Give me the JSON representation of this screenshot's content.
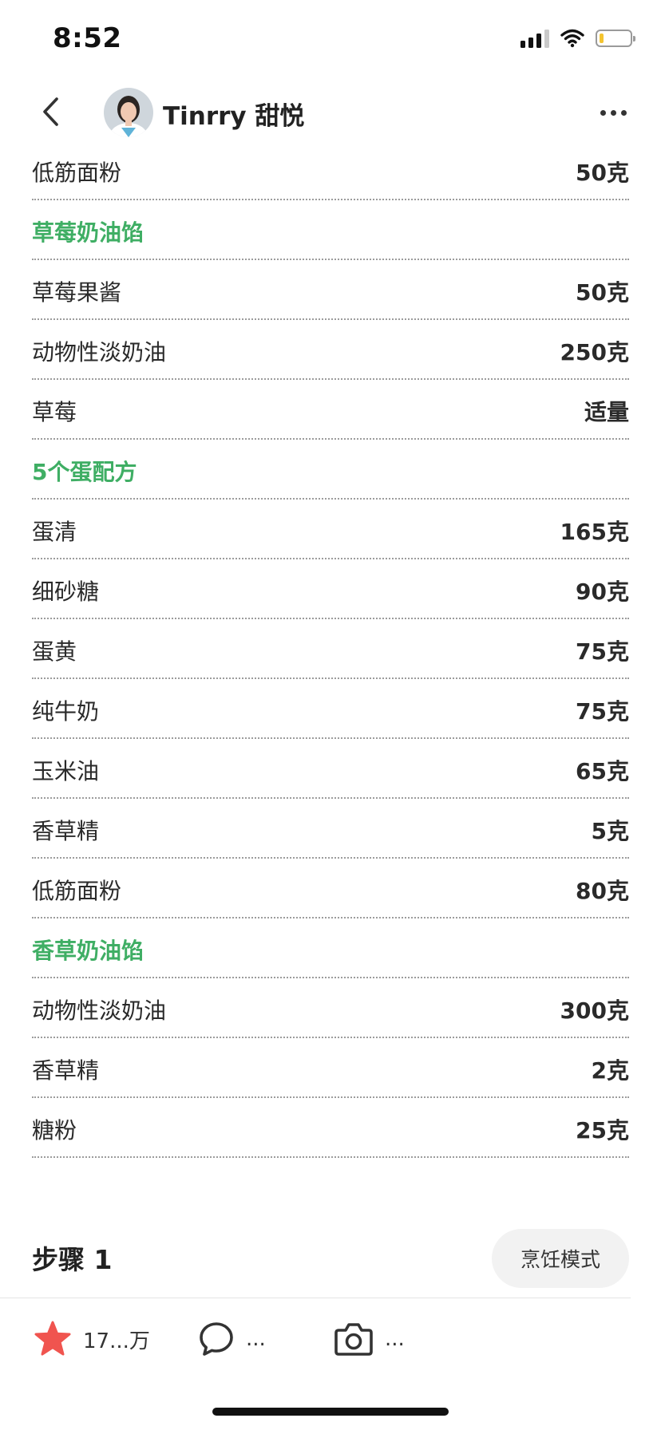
{
  "status_bar": {
    "time": "8:52"
  },
  "nav": {
    "author_name": "Tinrry 甜悦",
    "icons": [
      "chevron-left-icon",
      "avatar",
      "more-dots-icon"
    ]
  },
  "ingredients": [
    {
      "name": "低筋面粉",
      "amount": "50克",
      "is_section": false
    },
    {
      "name": "草莓奶油馅",
      "amount": "",
      "is_section": true
    },
    {
      "name": "草莓果酱",
      "amount": "50克",
      "is_section": false
    },
    {
      "name": "动物性淡奶油",
      "amount": "250克",
      "is_section": false
    },
    {
      "name": "草莓",
      "amount": "适量",
      "is_section": false
    },
    {
      "name": "5个蛋配方",
      "amount": "",
      "is_section": true
    },
    {
      "name": "蛋清",
      "amount": "165克",
      "is_section": false
    },
    {
      "name": "细砂糖",
      "amount": "90克",
      "is_section": false
    },
    {
      "name": "蛋黄",
      "amount": "75克",
      "is_section": false
    },
    {
      "name": "纯牛奶",
      "amount": "75克",
      "is_section": false
    },
    {
      "name": "玉米油",
      "amount": "65克",
      "is_section": false
    },
    {
      "name": "香草精",
      "amount": "5克",
      "is_section": false
    },
    {
      "name": "低筋面粉",
      "amount": "80克",
      "is_section": false
    },
    {
      "name": "香草奶油馅",
      "amount": "",
      "is_section": true
    },
    {
      "name": "动物性淡奶油",
      "amount": "300克",
      "is_section": false
    },
    {
      "name": "香草精",
      "amount": "2克",
      "is_section": false
    },
    {
      "name": "糖粉",
      "amount": "25克",
      "is_section": false
    }
  ],
  "steps": {
    "title": "步骤 1",
    "cook_mode_label": "烹饪模式"
  },
  "bottom_bar": {
    "favorite_count": "17...万",
    "comment_count": "...",
    "photo_count": "..."
  },
  "colors": {
    "section_green": "#3fae64",
    "favorite_red": "#f0544f",
    "battery_yellow": "#f4c430"
  }
}
